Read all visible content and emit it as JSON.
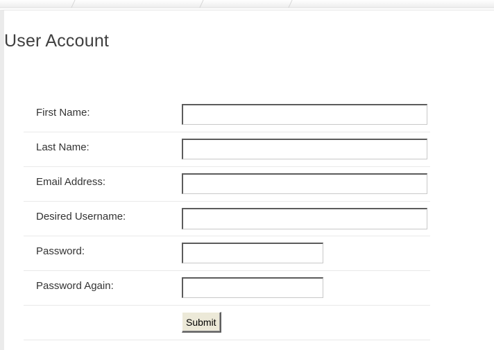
{
  "page": {
    "title": "User Account"
  },
  "form": {
    "fields": [
      {
        "label": "First Name:",
        "value": "",
        "type": "text"
      },
      {
        "label": "Last Name:",
        "value": "",
        "type": "text"
      },
      {
        "label": "Email Address:",
        "value": "",
        "type": "text"
      },
      {
        "label": "Desired Username:",
        "value": "",
        "type": "text"
      },
      {
        "label": "Password:",
        "value": "",
        "type": "password"
      },
      {
        "label": "Password Again:",
        "value": "",
        "type": "password"
      }
    ],
    "submit_label": "Submit"
  }
}
